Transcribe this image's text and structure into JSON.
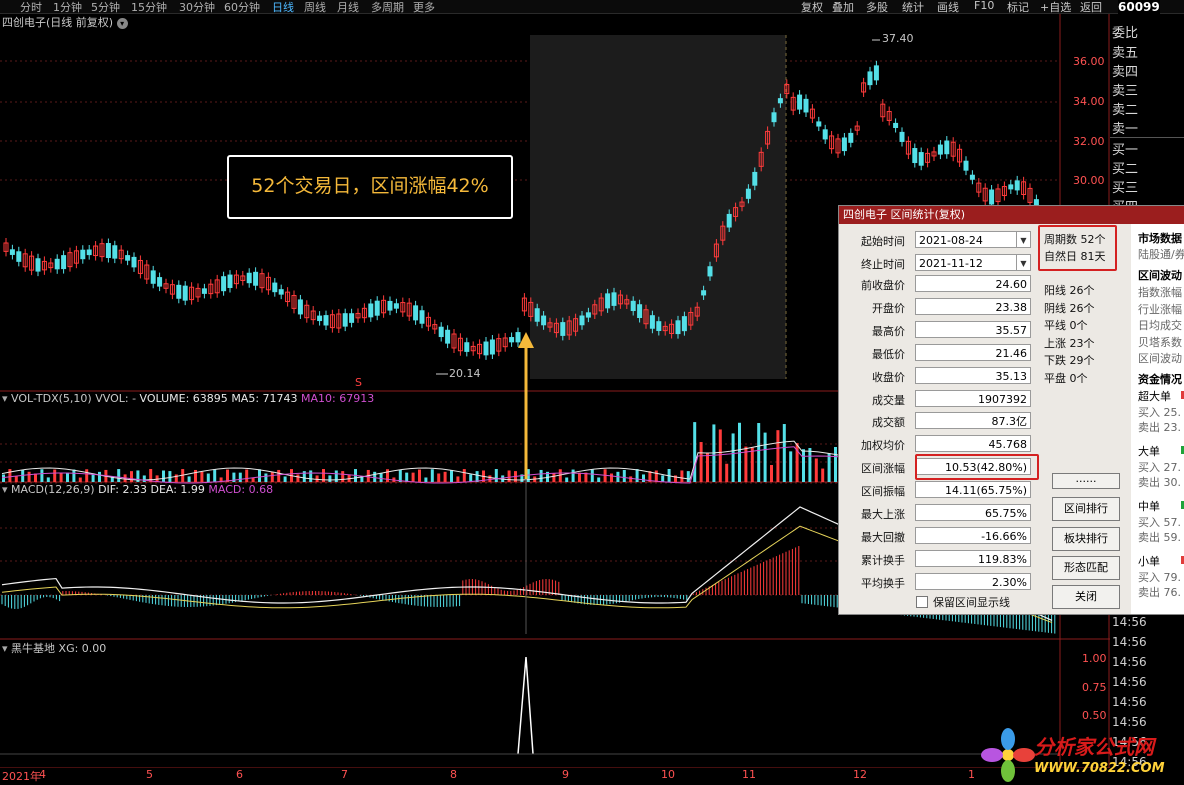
{
  "toolbar": {
    "periods": [
      "分时",
      "1分钟",
      "5分钟",
      "15分钟",
      "30分钟",
      "60分钟",
      "日线",
      "周线",
      "月线",
      "多周期",
      "更多"
    ],
    "active": "日线",
    "right_buttons": [
      "复权",
      "叠加",
      "多股",
      "统计",
      "画线",
      "F10",
      "标记",
      "+自选",
      "返回"
    ],
    "stock_code": "60099"
  },
  "main_panel": {
    "title": "四创电子(日线 前复权)",
    "high_label": "37.40",
    "low_label": "20.14",
    "price_axis": [
      "36.00",
      "34.00",
      "32.00",
      "30.00"
    ],
    "s_marker": "S"
  },
  "annotation": "52个交易日，区间涨幅42%",
  "vol_panel": {
    "name": "VOL-TDX(5,10)",
    "vvol": "VVOL: -",
    "volume": "VOLUME: 63895",
    "ma5": "MA5: 71743",
    "ma10": "MA10: 67913"
  },
  "macd_panel": {
    "name": "MACD(12,26,9)",
    "dif": "DIF: 2.33",
    "dea": "DEA: 1.99",
    "macd": "MACD: 0.68"
  },
  "xg_panel": {
    "name": "黑牛基地",
    "xg": "XG: 0.00",
    "axis": [
      "1.00",
      "0.75",
      "0.50"
    ]
  },
  "x_axis": [
    "2021年",
    "4",
    "5",
    "6",
    "7",
    "8",
    "9",
    "10",
    "11",
    "12",
    "1"
  ],
  "orderbook": {
    "header": "委比",
    "sell": [
      "卖五",
      "卖四",
      "卖三",
      "卖二",
      "卖一"
    ],
    "buy": [
      "买一",
      "买二",
      "买三",
      "买四"
    ]
  },
  "times": [
    "14:56",
    "14:56",
    "14:56",
    "14:56",
    "14:56",
    "14:56",
    "14:56",
    "14:56"
  ],
  "dialog": {
    "title": "四创电子 区间统计(复权)",
    "start_label": "起始时间",
    "start": "2021-08-24",
    "end_label": "终止时间",
    "end": "2021-11-12",
    "rows": [
      {
        "label": "前收盘价",
        "value": "24.60"
      },
      {
        "label": "开盘价",
        "value": "23.38"
      },
      {
        "label": "最高价",
        "value": "35.57"
      },
      {
        "label": "最低价",
        "value": "21.46"
      },
      {
        "label": "收盘价",
        "value": "35.13"
      },
      {
        "label": "成交量",
        "value": "1907392"
      },
      {
        "label": "成交额",
        "value": "87.3亿"
      },
      {
        "label": "加权均价",
        "value": "45.768"
      },
      {
        "label": "区间涨幅",
        "value": "10.53(42.80%)"
      },
      {
        "label": "区间振幅",
        "value": "14.11(65.75%)"
      },
      {
        "label": "最大上涨",
        "value": "65.75%"
      },
      {
        "label": "最大回撤",
        "value": "-16.66%"
      },
      {
        "label": "累计换手",
        "value": "119.83%"
      },
      {
        "label": "平均换手",
        "value": "2.30%"
      }
    ],
    "period_count": "周期数 52个",
    "natural_days": "自然日 81天",
    "counts": [
      "阳线 26个",
      "阴线 26个",
      "平线 0个",
      "上涨 23个",
      "下跌 29个",
      "平盘 0个"
    ],
    "buttons": [
      "......",
      "区间排行",
      "板块排行",
      "形态匹配",
      "关闭"
    ],
    "checkbox": "保留区间显示线"
  },
  "right_info": {
    "market_title": "市场数据",
    "market_sub": "陆股通/券",
    "volatility_title": "区间波动",
    "vol_items": [
      "指数涨幅",
      "行业涨幅",
      "日均成交",
      "贝塔系数",
      "区间波动"
    ],
    "fund_title": "资金情况",
    "funds": [
      {
        "name": "超大单",
        "buy": "买入 25.",
        "sell": "卖出 23."
      },
      {
        "name": "大单",
        "buy": "买入 27.",
        "sell": "卖出 30."
      },
      {
        "name": "中单",
        "buy": "买入 57.",
        "sell": "卖出 59."
      },
      {
        "name": "小单",
        "buy": "买入 79.",
        "sell": "卖出 76."
      }
    ]
  },
  "logo": {
    "text": "分析家公式网",
    "url": "WWW.70822.COM"
  }
}
